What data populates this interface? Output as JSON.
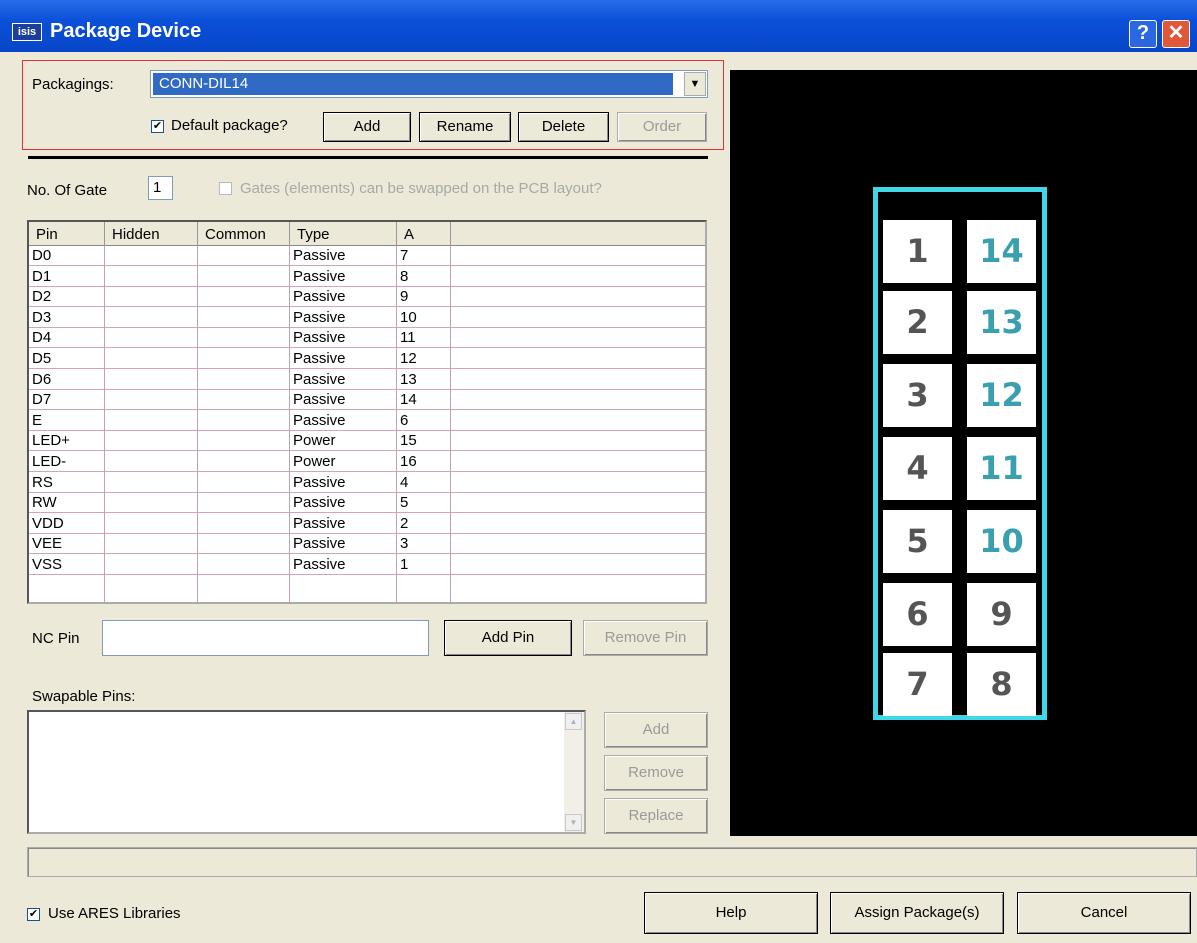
{
  "window": {
    "title": "Package Device",
    "app_badge": "isis",
    "help_symbol": "?",
    "close_symbol": "✕"
  },
  "packagings": {
    "label": "Packagings:",
    "selected": "CONN-DIL14",
    "default_checked": "✔",
    "default_label": "Default package?",
    "add_label": "Add",
    "rename_label": "Rename",
    "delete_label": "Delete",
    "order_label": "Order"
  },
  "gates": {
    "label": "No. Of Gate",
    "value": "1",
    "swap_label": "Gates (elements) can be swapped on the PCB layout?"
  },
  "pin_table": {
    "columns": [
      "Pin",
      "Hidden",
      "Common",
      "Type",
      "A"
    ],
    "rows": [
      {
        "pin": "D0",
        "type": "Passive",
        "a": "7"
      },
      {
        "pin": "D1",
        "type": "Passive",
        "a": "8"
      },
      {
        "pin": "D2",
        "type": "Passive",
        "a": "9"
      },
      {
        "pin": "D3",
        "type": "Passive",
        "a": "10"
      },
      {
        "pin": "D4",
        "type": "Passive",
        "a": "11"
      },
      {
        "pin": "D5",
        "type": "Passive",
        "a": "12"
      },
      {
        "pin": "D6",
        "type": "Passive",
        "a": "13"
      },
      {
        "pin": "D7",
        "type": "Passive",
        "a": "14"
      },
      {
        "pin": "E",
        "type": "Passive",
        "a": "6"
      },
      {
        "pin": "LED+",
        "type": "Power",
        "a": "15"
      },
      {
        "pin": "LED-",
        "type": "Power",
        "a": "16"
      },
      {
        "pin": "RS",
        "type": "Passive",
        "a": "4"
      },
      {
        "pin": "RW",
        "type": "Passive",
        "a": "5"
      },
      {
        "pin": "VDD",
        "type": "Passive",
        "a": "2"
      },
      {
        "pin": "VEE",
        "type": "Passive",
        "a": "3"
      },
      {
        "pin": "VSS",
        "type": "Passive",
        "a": "1"
      }
    ]
  },
  "nc_pin": {
    "label": "NC Pin",
    "value": "",
    "add_label": "Add Pin",
    "remove_label": "Remove Pin"
  },
  "swapable": {
    "label": "Swapable Pins:",
    "add_label": "Add",
    "remove_label": "Remove",
    "replace_label": "Replace"
  },
  "footer": {
    "use_ares_checked": "✔",
    "use_ares_label": "Use ARES Libraries",
    "help_label": "Help",
    "assign_label": "Assign Package(s)",
    "cancel_label": "Cancel"
  },
  "preview": {
    "pads_left": [
      "1",
      "2",
      "3",
      "4",
      "5",
      "6",
      "7"
    ],
    "pads_right": [
      "14",
      "13",
      "12",
      "11",
      "10",
      "9",
      "8"
    ],
    "outline_color": "#40d8e8",
    "background_color": "#000000"
  }
}
